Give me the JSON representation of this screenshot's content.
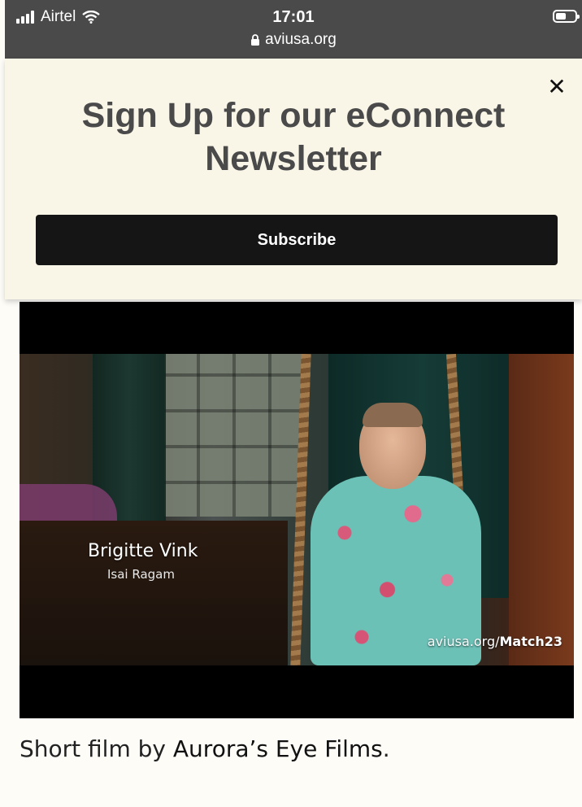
{
  "status_bar": {
    "carrier": "Airtel",
    "time": "17:01",
    "url": "aviusa.org"
  },
  "banner": {
    "headline": "Sign Up for our eConnect Newsletter",
    "subscribe_label": "Subscribe",
    "close_glyph": "✕"
  },
  "video": {
    "name": "Brigitte Vink",
    "subtitle": "Isai Ragam",
    "watermark_prefix": "aviusa.org/",
    "watermark_bold": "Match23"
  },
  "caption": {
    "prefix": "Short film by ",
    "link_text": "Aurora’s Eye Films",
    "suffix": "."
  },
  "colors": {
    "status_bar_bg": "#4a4a4a",
    "banner_bg": "#f9f5e7",
    "button_bg": "#151515",
    "page_bg": "#fdfcf7"
  }
}
